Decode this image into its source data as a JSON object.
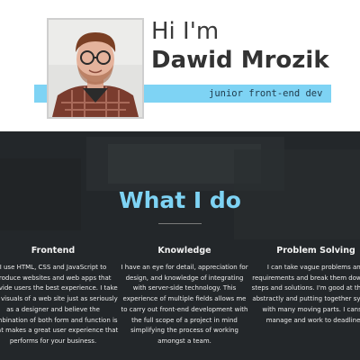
{
  "hero": {
    "greeting": "Hi I'm",
    "name": "Dawid Mrozik",
    "role": "junior front-end dev",
    "photo_icon": "profile-photo",
    "accent_color": "#7ed3f4"
  },
  "what_i_do": {
    "title": "What I do",
    "title_color": "#7ed3f4",
    "background_color": "#24282b",
    "columns": [
      {
        "title": "Frontend",
        "text": "I use HTML, CSS and JavaScript to produce websites and web apps that provide users the best experience. I take the visuals of a web site just as seriously as a designer and believe the combination of both form and function is what makes a great user experience that performs for your business."
      },
      {
        "title": "Knowledge",
        "text": "I have an eye for detail, appreciation for design, and knowledge of integrating with server-side technology. This experience of multiple fields allows me to carry out front-end development with the full scope of a project in mind simplifying the process of working amongst a team."
      },
      {
        "title": "Problem Solving",
        "text": "I can take vague problems and requirements and break them down into steps and solutions. I'm good at thinking abstractly and putting together systems with many moving parts. I canself manage and work to deadlines."
      }
    ]
  }
}
